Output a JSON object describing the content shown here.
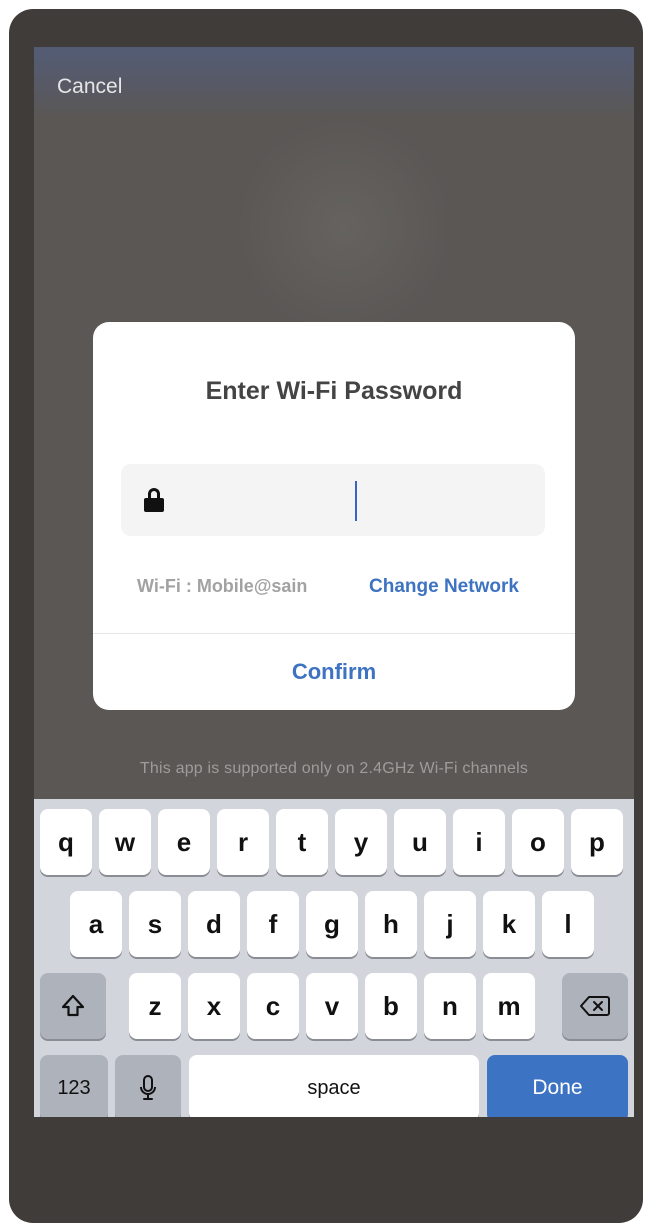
{
  "header": {
    "cancel_label": "Cancel"
  },
  "dialog": {
    "title": "Enter Wi-Fi Password",
    "password_value": "",
    "wifi_label": "Wi-Fi : Mobile@sain",
    "change_network_label": "Change Network",
    "confirm_label": "Confirm"
  },
  "support_note": "This app is supported only on 2.4GHz Wi-Fi channels",
  "keyboard": {
    "row1": [
      "q",
      "w",
      "e",
      "r",
      "t",
      "y",
      "u",
      "i",
      "o",
      "p"
    ],
    "row2": [
      "a",
      "s",
      "d",
      "f",
      "g",
      "h",
      "j",
      "k",
      "l"
    ],
    "row3": [
      "z",
      "x",
      "c",
      "v",
      "b",
      "n",
      "m"
    ],
    "numbers_label": "123",
    "space_label": "space",
    "done_label": "Done",
    "shift_icon": "shift-icon",
    "backspace_icon": "backspace-icon",
    "microphone_icon": "microphone-icon"
  },
  "colors": {
    "accent": "#3e73c2",
    "done_key": "#3c73c2",
    "overlay": "#5a5755",
    "frame": "#3f3c3a"
  }
}
